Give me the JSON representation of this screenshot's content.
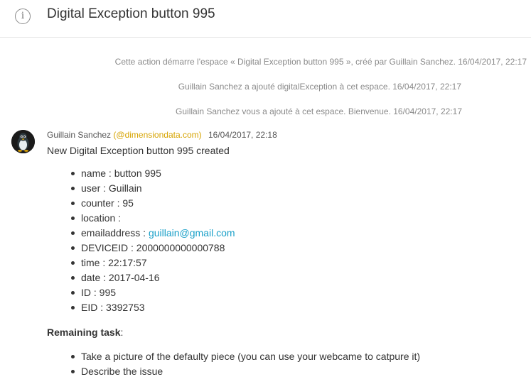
{
  "header": {
    "icon": "info-icon",
    "title": "Digital Exception button 995"
  },
  "system_messages": [
    "Cette action démarre l'espace « Digital Exception button 995 », créé par Guillain Sanchez. 16/04/2017, 22:17",
    "Guillain Sanchez a ajouté digitalException à cet espace. 16/04/2017, 22:17",
    "Guillain Sanchez vous a ajouté à cet espace. Bienvenue. 16/04/2017, 22:17"
  ],
  "post": {
    "avatar_icon": "penguin-avatar-icon",
    "author": "Guillain Sanchez",
    "handle": "(@dimensiondata.com)",
    "time": "16/04/2017, 22:18",
    "title": "New Digital Exception button 995 created",
    "fields": [
      {
        "label": "name : ",
        "value": "button 995"
      },
      {
        "label": "user : ",
        "value": "Guillain"
      },
      {
        "label": "counter : ",
        "value": "95"
      },
      {
        "label": "location : ",
        "value": ""
      },
      {
        "label": "emailaddress : ",
        "value": "guillain@gmail.com",
        "link": true
      },
      {
        "label": "DEVICEID : ",
        "value": "2000000000000788"
      },
      {
        "label": "time : ",
        "value": "22:17:57"
      },
      {
        "label": "date : ",
        "value": "2017-04-16"
      },
      {
        "label": "ID : ",
        "value": "995"
      },
      {
        "label": "EID : ",
        "value": "3392753"
      }
    ],
    "remaining_label": "Remaining task",
    "remaining_suffix": ":",
    "tasks": [
      "Take a picture of the defaulty piece (you can use your webcame to catpure it)",
      "Describe the issue"
    ]
  },
  "colors": {
    "link": "#1aa0c8",
    "handle": "#d6a300",
    "system_text": "#8a8a8a"
  }
}
